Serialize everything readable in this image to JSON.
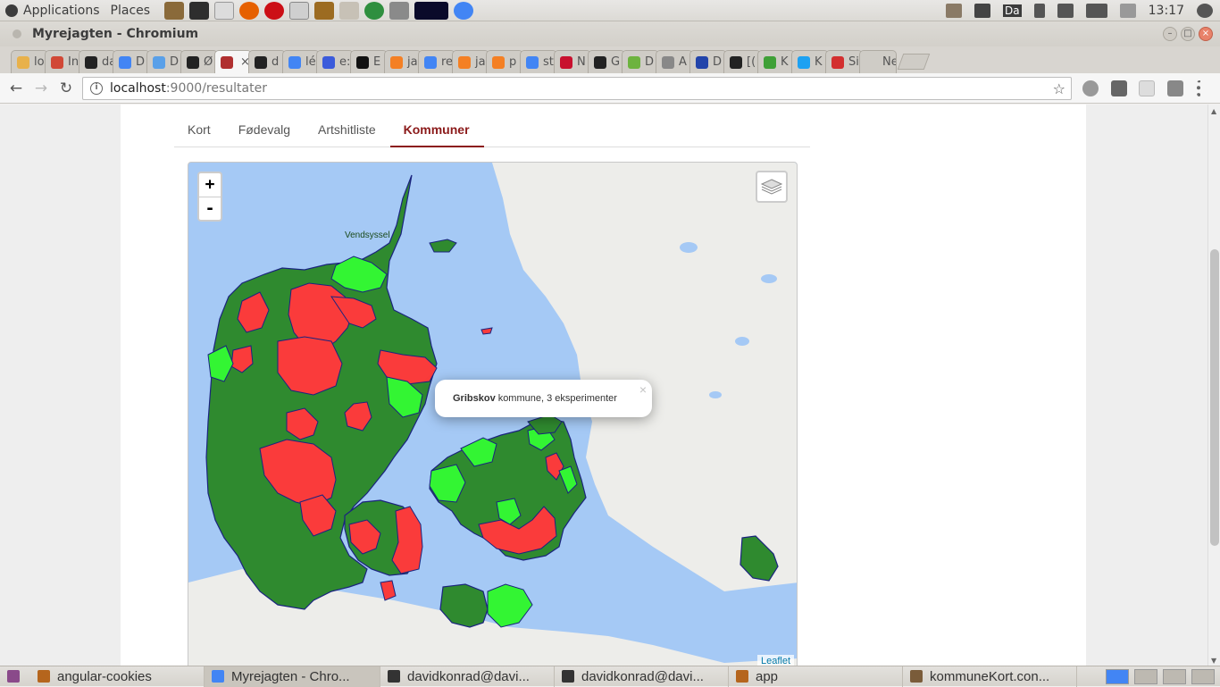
{
  "top_panel": {
    "applications": "Applications",
    "places": "Places",
    "clock": "13:17",
    "tray_text": "Da"
  },
  "window": {
    "title": "Myrejagten - Chromium"
  },
  "tabs": [
    {
      "label": "lo",
      "color": "#e8b14b"
    },
    {
      "label": "In",
      "color": "#d14836"
    },
    {
      "label": "da",
      "color": "#222222"
    },
    {
      "label": "D",
      "color": "#4285f4"
    },
    {
      "label": "D",
      "color": "#5aa0e8"
    },
    {
      "label": "Ø",
      "color": "#222222"
    },
    {
      "label": "",
      "color": "#b03030",
      "active": true
    },
    {
      "label": "d",
      "color": "#222222"
    },
    {
      "label": "lé",
      "color": "#4285f4"
    },
    {
      "label": "e:",
      "color": "#3b5bdb"
    },
    {
      "label": "E",
      "color": "#111111"
    },
    {
      "label": "ja",
      "color": "#f48024"
    },
    {
      "label": "re",
      "color": "#4285f4"
    },
    {
      "label": "ja",
      "color": "#f48024"
    },
    {
      "label": "p",
      "color": "#f48024"
    },
    {
      "label": "st",
      "color": "#4285f4"
    },
    {
      "label": "N",
      "color": "#c8102e"
    },
    {
      "label": "G",
      "color": "#222222"
    },
    {
      "label": "D",
      "color": "#6db33f"
    },
    {
      "label": "A",
      "color": "#888888"
    },
    {
      "label": "D",
      "color": "#2244aa"
    },
    {
      "label": "[(",
      "color": "#222222"
    },
    {
      "label": "K",
      "color": "#3fa037"
    },
    {
      "label": "K",
      "color": "#1da1f2"
    },
    {
      "label": "Si",
      "color": "#d32f2f"
    },
    {
      "label": "New",
      "color": "#cfccc6"
    }
  ],
  "address_bar": {
    "host": "localhost",
    "path": ":9000/resultater"
  },
  "nav_tabs": [
    {
      "label": "Kort",
      "active": false
    },
    {
      "label": "Fødevalg",
      "active": false
    },
    {
      "label": "Artshitliste",
      "active": false
    },
    {
      "label": "Kommuner",
      "active": true
    }
  ],
  "map": {
    "zoom_in": "+",
    "zoom_out": "-",
    "attribution": "Leaflet",
    "popup": {
      "name": "Gribskov",
      "text": "kommune, 3 eksperimenter",
      "close": "×"
    },
    "colors": {
      "sea": "#a5c9f5",
      "land": "#ededea",
      "dark_green": "#2f8a2f",
      "light_green": "#33f533",
      "red": "#fa3b3b",
      "border": "#1a237e"
    },
    "basemap_labels": [
      "Vendsyssel"
    ]
  },
  "taskbar": [
    {
      "label": "angular-cookies",
      "color": "#b5651d"
    },
    {
      "label": "Myrejagten - Chro...",
      "color": "#4285f4",
      "active": true
    },
    {
      "label": "davidkonrad@davi...",
      "color": "#333333"
    },
    {
      "label": "davidkonrad@davi...",
      "color": "#333333"
    },
    {
      "label": "app",
      "color": "#b5651d"
    },
    {
      "label": "kommuneKort.con...",
      "color": "#7a5c3a"
    }
  ]
}
